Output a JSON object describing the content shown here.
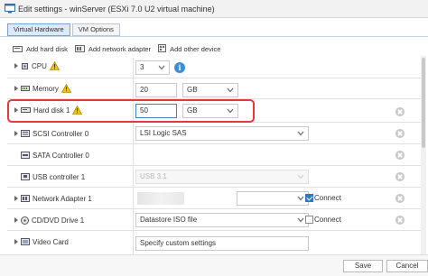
{
  "window": {
    "title": "Edit settings - winServer (ESXi 7.0 U2 virtual machine)",
    "title_icon": "vm-edit-icon"
  },
  "tabs": [
    {
      "label": "Virtual Hardware",
      "active": true
    },
    {
      "label": "VM Options",
      "active": false
    }
  ],
  "toolbar": {
    "add_hard_disk": "Add hard disk",
    "add_network_adapter": "Add network adapter",
    "add_other_device": "Add other device"
  },
  "hardware": {
    "cpu": {
      "label": "CPU",
      "value": "3",
      "warning": true
    },
    "memory": {
      "label": "Memory",
      "value": "20",
      "unit": "GB",
      "warning": true
    },
    "hard_disk": {
      "label": "Hard disk 1",
      "value": "50",
      "unit": "GB",
      "warning": true,
      "highlighted": true
    },
    "scsi": {
      "label": "SCSI Controller 0",
      "value": "LSI Logic SAS"
    },
    "sata": {
      "label": "SATA Controller 0"
    },
    "usb": {
      "label": "USB controller 1",
      "value": "USB 3.1",
      "disabled": true
    },
    "network": {
      "label": "Network Adapter 1",
      "connect_label": "Connect",
      "connected": true
    },
    "cddvd": {
      "label": "CD/DVD Drive 1",
      "value": "Datastore ISO file",
      "connect_label": "Connect",
      "connected": false
    },
    "video": {
      "label": "Video Card",
      "value": "Specify custom settings"
    }
  },
  "footer": {
    "save": "Save",
    "cancel": "Cancel"
  },
  "colors": {
    "highlight": "#e0393e",
    "accent": "#2f78c4",
    "warning": "#f5c400"
  }
}
